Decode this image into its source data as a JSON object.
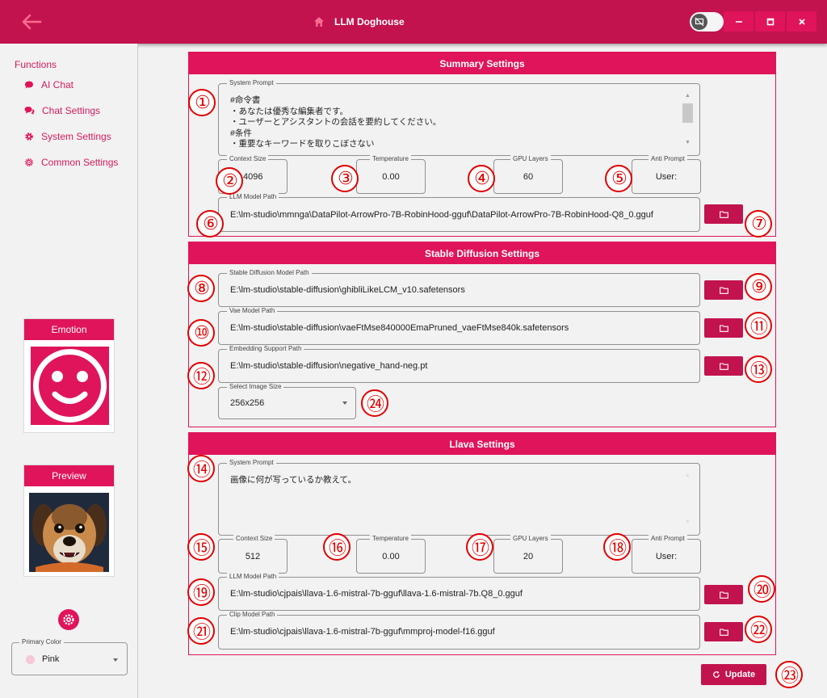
{
  "window": {
    "title": "LLM Doghouse"
  },
  "sidebar": {
    "section_label": "Functions",
    "items": [
      {
        "label": "AI Chat"
      },
      {
        "label": "Chat Settings"
      },
      {
        "label": "System Settings"
      },
      {
        "label": "Common Settings"
      }
    ],
    "emotion_label": "Emotion",
    "preview_label": "Preview",
    "primary_color": {
      "label": "Primary Color",
      "value": "Pink"
    }
  },
  "summary": {
    "header": "Summary Settings",
    "system_prompt_label": "System Prompt",
    "system_prompt": "#命令書\n・あなたは優秀な編集者です。\n・ユーザーとアシスタントの会話を要約してください。\n#条件\n・重要なキーワードを取りこぼさない",
    "context_size_label": "Context Size",
    "context_size": "4096",
    "temperature_label": "Temperature",
    "temperature": "0.00",
    "gpu_layers_label": "GPU Layers",
    "gpu_layers": "60",
    "anti_prompt_label": "Anti Prompt",
    "anti_prompt": "User:",
    "llm_model_path_label": "LLM Model Path",
    "llm_model_path": "E:\\lm-studio\\mmnga\\DataPilot-ArrowPro-7B-RobinHood-gguf\\DataPilot-ArrowPro-7B-RobinHood-Q8_0.gguf"
  },
  "stable_diffusion": {
    "header": "Stable Diffusion Settings",
    "model_path_label": "Stable Diffusion Model Path",
    "model_path": "E:\\lm-studio\\stable-diffusion\\ghibliLikeLCM_v10.safetensors",
    "vae_path_label": "Vae Model Path",
    "vae_path": "E:\\lm-studio\\stable-diffusion\\vaeFtMse840000EmaPruned_vaeFtMse840k.safetensors",
    "embedding_path_label": "Embedding Support Path",
    "embedding_path": "E:\\lm-studio\\stable-diffusion\\negative_hand-neg.pt",
    "image_size_label": "Select Image Size",
    "image_size": "256x256"
  },
  "llava": {
    "header": "Llava Settings",
    "system_prompt_label": "System Prompt",
    "system_prompt": "画像に何が写っているか教えて。",
    "context_size_label": "Context Size",
    "context_size": "512",
    "temperature_label": "Temperature",
    "temperature": "0.00",
    "gpu_layers_label": "GPU Layers",
    "gpu_layers": "20",
    "anti_prompt_label": "Anti Prompt",
    "anti_prompt": "User:",
    "llm_model_path_label": "LLM Model Path",
    "llm_model_path": "E:\\lm-studio\\cjpais\\llava-1.6-mistral-7b-gguf\\llava-1.6-mistral-7b.Q8_0.gguf",
    "clip_model_path_label": "Clip Model Path",
    "clip_model_path": "E:\\lm-studio\\cjpais\\llava-1.6-mistral-7b-gguf\\mmproj-model-f16.gguf"
  },
  "update_label": "Update",
  "markers": [
    "①",
    "②",
    "③",
    "④",
    "⑤",
    "⑥",
    "⑦",
    "⑧",
    "⑨",
    "⑩",
    "⑪",
    "⑫",
    "⑬",
    "⑭",
    "⑮",
    "⑯",
    "⑰",
    "⑱",
    "⑲",
    "⑳",
    "㉑",
    "㉒",
    "㉓",
    "㉔"
  ],
  "colors": {
    "primary": "#e0145a",
    "titlebar": "#c2134f",
    "marker": "#e00000"
  },
  "icons": {
    "back": "arrow-left-icon",
    "title": "home-icon",
    "theme_toggle": "screen-off-icon",
    "minimize": "minimize-icon",
    "maximize": "maximize-icon",
    "close": "close-icon",
    "nav": [
      "chat-bubble-icon",
      "chat-bubbles-icon",
      "gear-icon",
      "gear-outline-icon"
    ],
    "emotion": "smiley-face-icon",
    "palette": "palette-icon",
    "folder": "folder-icon",
    "update": "refresh-icon"
  }
}
